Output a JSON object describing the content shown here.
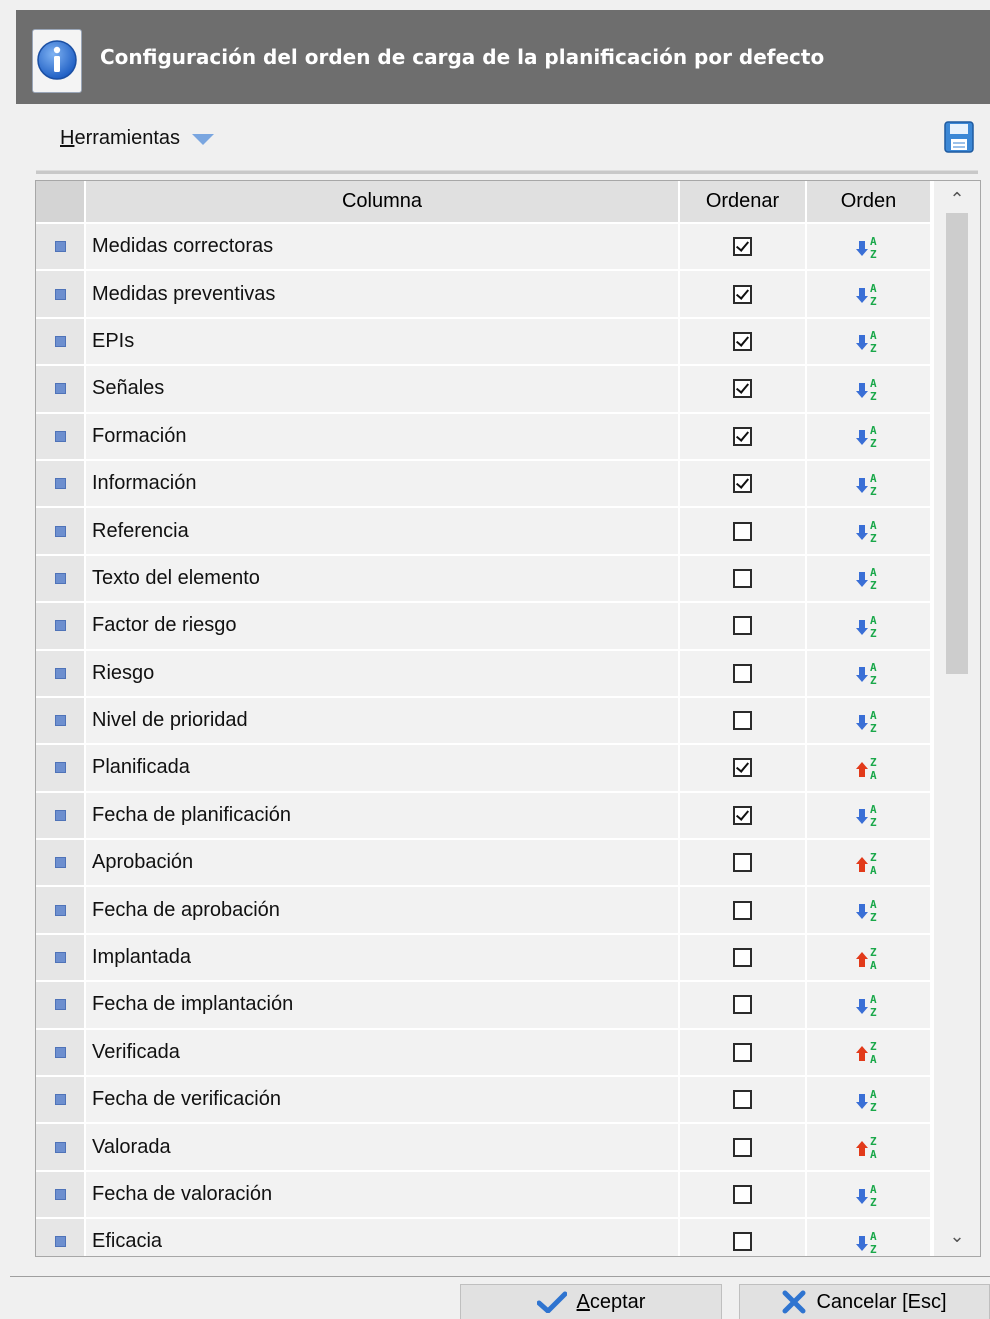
{
  "header": {
    "title": "Configuración del orden de carga de la planificación por defecto",
    "icon": "info-icon"
  },
  "toolbar": {
    "tools_label": "Herramientas",
    "tools_icon": "chevron-down-icon",
    "save_icon": "save-icon"
  },
  "grid": {
    "columns": [
      "Columna",
      "Ordenar",
      "Orden"
    ],
    "rows": [
      {
        "name": "Medidas correctoras",
        "ordenar": true,
        "orden": "asc"
      },
      {
        "name": "Medidas preventivas",
        "ordenar": true,
        "orden": "asc"
      },
      {
        "name": "EPIs",
        "ordenar": true,
        "orden": "asc"
      },
      {
        "name": "Señales",
        "ordenar": true,
        "orden": "asc"
      },
      {
        "name": "Formación",
        "ordenar": true,
        "orden": "asc"
      },
      {
        "name": "Información",
        "ordenar": true,
        "orden": "asc"
      },
      {
        "name": "Referencia",
        "ordenar": false,
        "orden": "asc"
      },
      {
        "name": "Texto del elemento",
        "ordenar": false,
        "orden": "asc"
      },
      {
        "name": "Factor de riesgo",
        "ordenar": false,
        "orden": "asc"
      },
      {
        "name": "Riesgo",
        "ordenar": false,
        "orden": "asc"
      },
      {
        "name": "Nivel de prioridad",
        "ordenar": false,
        "orden": "asc"
      },
      {
        "name": "Planificada",
        "ordenar": true,
        "orden": "desc"
      },
      {
        "name": "Fecha de planificación",
        "ordenar": true,
        "orden": "asc"
      },
      {
        "name": "Aprobación",
        "ordenar": false,
        "orden": "desc"
      },
      {
        "name": "Fecha de aprobación",
        "ordenar": false,
        "orden": "asc"
      },
      {
        "name": "Implantada",
        "ordenar": false,
        "orden": "desc"
      },
      {
        "name": "Fecha de implantación",
        "ordenar": false,
        "orden": "asc"
      },
      {
        "name": "Verificada",
        "ordenar": false,
        "orden": "desc"
      },
      {
        "name": "Fecha de verificación",
        "ordenar": false,
        "orden": "asc"
      },
      {
        "name": "Valorada",
        "ordenar": false,
        "orden": "desc"
      },
      {
        "name": "Fecha de valoración",
        "ordenar": false,
        "orden": "asc"
      },
      {
        "name": "Eficacia",
        "ordenar": false,
        "orden": "asc"
      }
    ],
    "scroll_position": 0,
    "scroll_visible_fraction": 0.46
  },
  "footer": {
    "accept_label": "Aceptar",
    "cancel_label": "Cancelar  [Esc]"
  },
  "colors": {
    "title_bg": "#6e6e6e",
    "asc_arrow": "#3a6fd6",
    "desc_arrow": "#e23a1a",
    "az_letters": "#1aa84a"
  }
}
